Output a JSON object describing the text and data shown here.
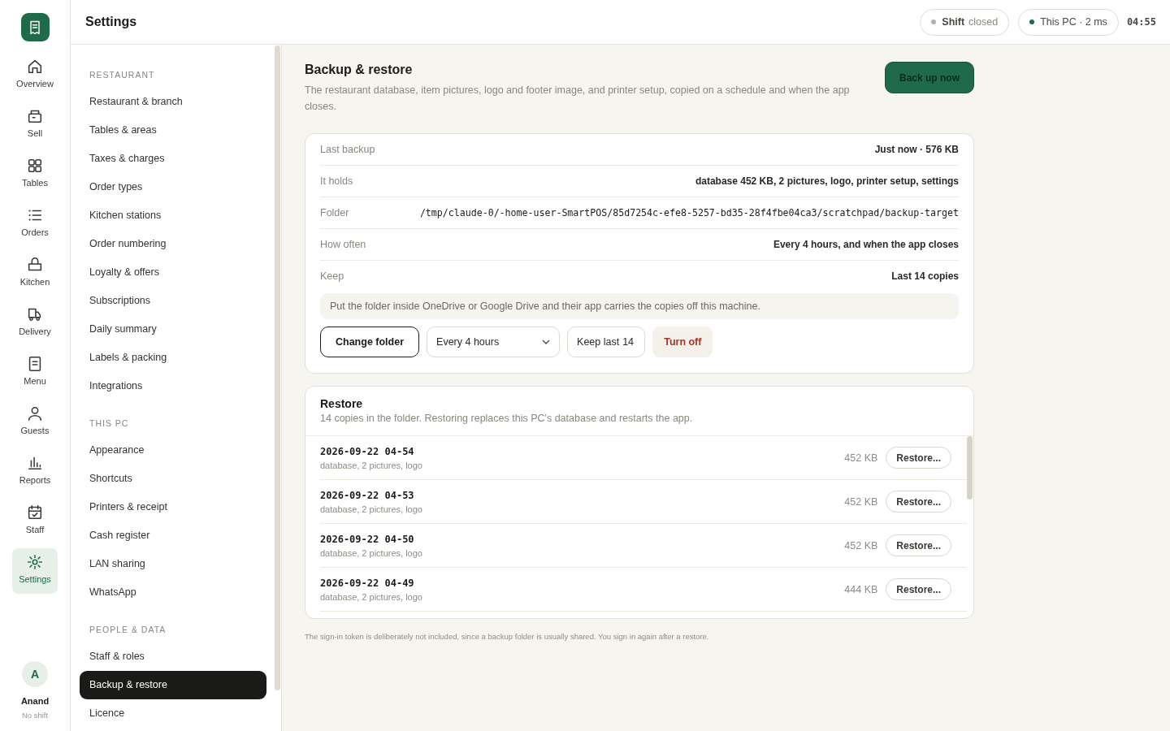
{
  "rail": {
    "items": [
      {
        "label": "Overview",
        "selected": false
      },
      {
        "label": "Sell",
        "selected": false
      },
      {
        "label": "Tables",
        "selected": false
      },
      {
        "label": "Orders",
        "selected": false
      },
      {
        "label": "Kitchen",
        "selected": false
      },
      {
        "label": "Delivery",
        "selected": false
      },
      {
        "label": "Menu",
        "selected": false
      },
      {
        "label": "Guests",
        "selected": false
      },
      {
        "label": "Reports",
        "selected": false
      },
      {
        "label": "Staff",
        "selected": false
      },
      {
        "label": "Settings",
        "selected": true
      }
    ],
    "user": {
      "initial": "A",
      "name": "Anand",
      "status": "No shift"
    }
  },
  "header": {
    "title": "Settings",
    "status_pills": [
      {
        "label": "Shift",
        "value": "closed",
        "color": "#b5b2aa"
      },
      {
        "label": "This PC · 2 ms",
        "color": "#1f6a48"
      }
    ],
    "clock": "04:55"
  },
  "settings_nav": {
    "sections": [
      {
        "heading": "RESTAURANT",
        "items": [
          {
            "label": "Restaurant & branch",
            "selected": false
          },
          {
            "label": "Tables & areas",
            "selected": false
          },
          {
            "label": "Taxes & charges",
            "selected": false
          },
          {
            "label": "Order types",
            "selected": false
          },
          {
            "label": "Kitchen stations",
            "selected": false
          },
          {
            "label": "Order numbering",
            "selected": false
          },
          {
            "label": "Loyalty & offers",
            "selected": false
          },
          {
            "label": "Subscriptions",
            "selected": false
          },
          {
            "label": "Daily summary",
            "selected": false
          },
          {
            "label": "Labels & packing",
            "selected": false
          },
          {
            "label": "Integrations",
            "selected": false
          }
        ]
      },
      {
        "heading": "THIS PC",
        "items": [
          {
            "label": "Appearance",
            "selected": false
          },
          {
            "label": "Shortcuts",
            "selected": false
          },
          {
            "label": "Printers & receipt",
            "selected": false
          },
          {
            "label": "Cash register",
            "selected": false
          },
          {
            "label": "LAN sharing",
            "selected": false
          },
          {
            "label": "WhatsApp",
            "selected": false
          }
        ]
      },
      {
        "heading": "PEOPLE & DATA",
        "items": [
          {
            "label": "Staff & roles",
            "selected": false
          },
          {
            "label": "Backup & restore",
            "selected": true
          },
          {
            "label": "Licence",
            "selected": false
          }
        ]
      }
    ]
  },
  "backup": {
    "title": "Backup & restore",
    "description": "The restaurant database, item pictures, logo and footer image, and printer setup, copied on a schedule and when the app closes.",
    "action": "Back up now",
    "details": [
      {
        "label": "Last backup",
        "value": "Just now · 576 KB",
        "kind": "text"
      },
      {
        "label": "It holds",
        "value": "database 452 KB, 2 pictures, logo, printer setup, settings",
        "kind": "text"
      },
      {
        "label": "Folder",
        "value": "/tmp/claude-0/-home-user-SmartPOS/85d7254c-efe8-5257-bd35-28f4fbe04ca3/scratchpad/backup-target",
        "kind": "path"
      },
      {
        "label": "How often",
        "value": "Every 4 hours, and when the app closes",
        "kind": "text"
      },
      {
        "label": "Keep",
        "value": "Last 14 copies",
        "kind": "text"
      }
    ],
    "tip": "Put the folder inside OneDrive or Google Drive and their app carries the copies off this machine.",
    "change_folder": "Change folder",
    "frequency": "Every 4 hours",
    "keep": {
      "label": "Keep last",
      "value": "14"
    },
    "turn_off": "Turn off"
  },
  "restore": {
    "title": "Restore",
    "description": "14 copies in the folder. Restoring replaces this PC's database and restarts the app.",
    "copies": [
      {
        "timestamp": "2026-09-22 04-54",
        "contents": "database, 2 pictures, logo",
        "size": "452 KB",
        "button": "Restore..."
      },
      {
        "timestamp": "2026-09-22 04-53",
        "contents": "database, 2 pictures, logo",
        "size": "452 KB",
        "button": "Restore..."
      },
      {
        "timestamp": "2026-09-22 04-50",
        "contents": "database, 2 pictures, logo",
        "size": "452 KB",
        "button": "Restore..."
      },
      {
        "timestamp": "2026-09-22 04-49",
        "contents": "database, 2 pictures, logo",
        "size": "444 KB",
        "button": "Restore..."
      }
    ]
  },
  "note": "The sign-in token is deliberately not included, since a backup folder is usually shared. You sign in again after a restore."
}
